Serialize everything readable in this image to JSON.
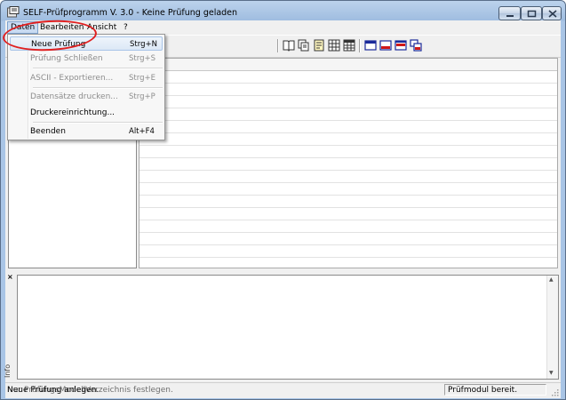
{
  "window": {
    "title": "SELF-Prüfprogramm V. 3.0 - Keine Prüfung geladen"
  },
  "menubar": {
    "items": [
      "Daten",
      "Bearbeiten",
      "Ansicht",
      "?"
    ],
    "active": "Daten"
  },
  "dropdown": {
    "items": [
      {
        "label": "Neue Prüfung",
        "shortcut": "Strg+N",
        "enabled": true,
        "highlighted": true
      },
      {
        "label": "Prüfung Schließen",
        "shortcut": "Strg+S",
        "enabled": false
      },
      {
        "label": "ASCII - Exportieren...",
        "shortcut": "Strg+E",
        "enabled": false
      },
      {
        "label": "Datensätze drucken...",
        "shortcut": "Strg+P",
        "enabled": false
      },
      {
        "label": "Druckereinrichtung...",
        "shortcut": "",
        "enabled": true
      },
      {
        "label": "Beenden",
        "shortcut": "Alt+F4",
        "enabled": true
      }
    ]
  },
  "toolbar": {
    "icons": [
      "book-icon",
      "copy-pages-icon",
      "document-icon",
      "table-icon",
      "table-grid-icon",
      "window-blue-icon",
      "window-red-icon",
      "window-split-icon",
      "window-cascade-icon"
    ]
  },
  "infopanel": {
    "close_label": "×",
    "side_label": "Info"
  },
  "statusbar": {
    "left_text": "Neue Prüfung anlegen.",
    "ghost_text": "Nur PrüfungsModellVerzeichnis festlegen.",
    "right_text": "Prüfmodul bereit."
  },
  "colors": {
    "annotation": "#e02020",
    "menu_highlight": "#c9dbf2",
    "titlebar": "#bcd3ec"
  }
}
